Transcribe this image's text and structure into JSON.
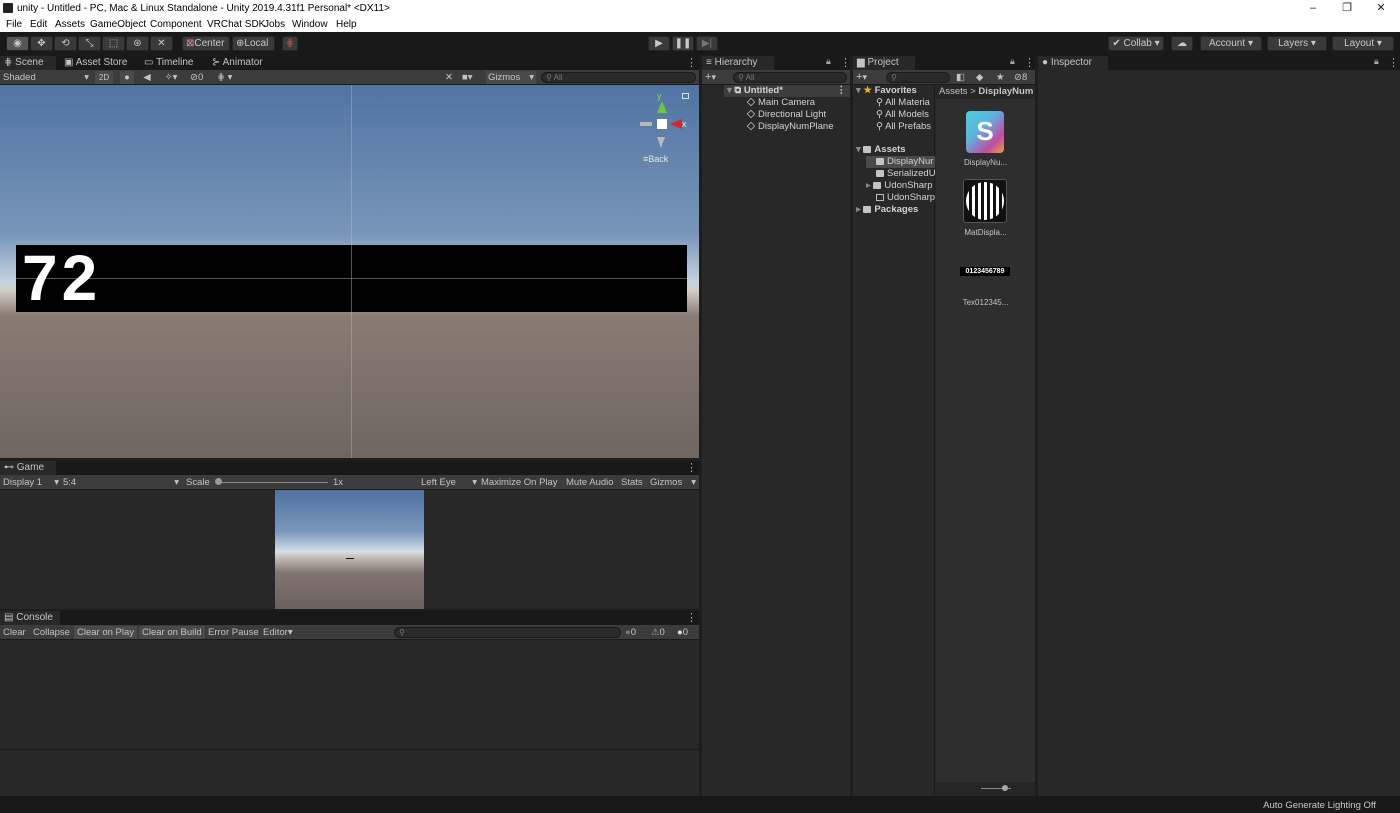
{
  "window": {
    "title": "unity - Untitled - PC, Mac & Linux Standalone - Unity 2019.4.31f1 Personal* <DX11>",
    "minimize": "–",
    "restore": "❐",
    "close": "✕"
  },
  "menu": [
    "File",
    "Edit",
    "Assets",
    "GameObject",
    "Component",
    "VRChat SDK",
    "Jobs",
    "Window",
    "Help"
  ],
  "toolbar": {
    "pivot": "Center",
    "space": "Local",
    "collab": "Collab",
    "account": "Account",
    "layers": "Layers",
    "layout": "Layout"
  },
  "scene": {
    "tabs": [
      "Scene",
      "Asset Store",
      "Timeline",
      "Animator"
    ],
    "shading": "Shaded",
    "mode2d": "2D",
    "hidden_count": "0",
    "gizmos": "Gizmos",
    "search_placeholder": "All",
    "display_number": "72",
    "gizmo_y": "y",
    "gizmo_x": "x",
    "view_back": "Back"
  },
  "game": {
    "tab": "Game",
    "display": "Display 1",
    "aspect": "5:4",
    "scale_label": "Scale",
    "scale_value": "1x",
    "eye": "Left Eye",
    "maximize": "Maximize On Play",
    "mute": "Mute Audio",
    "stats": "Stats",
    "gizmos": "Gizmos"
  },
  "console": {
    "tab": "Console",
    "buttons": [
      "Clear",
      "Collapse",
      "Clear on Play",
      "Clear on Build",
      "Error Pause",
      "Editor"
    ],
    "log_count": "0",
    "warning_count": "0",
    "error_count": "0"
  },
  "hierarchy": {
    "tab": "Hierarchy",
    "search_placeholder": "All",
    "scene": "Untitled*",
    "items": [
      "Main Camera",
      "Directional Light",
      "DisplayNumPlane"
    ]
  },
  "project": {
    "tab": "Project",
    "hidden_count": "8",
    "favorites": "Favorites",
    "favorite_items": [
      "All Materia",
      "All Models",
      "All Prefabs"
    ],
    "assets_root": "Assets",
    "asset_folders": [
      "DisplayNur",
      "SerializedU",
      "UdonSharp",
      "UdonSharp"
    ],
    "packages": "Packages",
    "breadcrumb_root": "Assets",
    "breadcrumb_sep": ">",
    "breadcrumb_current": "DisplayNum",
    "asset_items": [
      "DisplayNu...",
      "MatDispla...",
      "Tex012345..."
    ],
    "texture_preview_text": "0123456789"
  },
  "inspector": {
    "tab": "Inspector"
  },
  "status": {
    "lighting": "Auto Generate Lighting Off"
  }
}
